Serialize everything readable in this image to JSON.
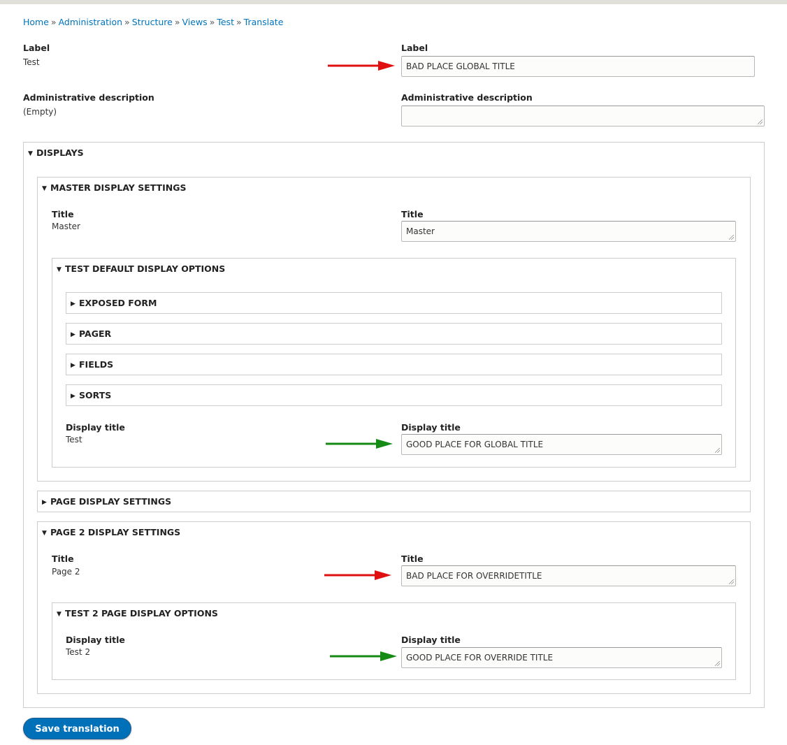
{
  "breadcrumb": {
    "items": [
      "Home",
      "Administration",
      "Structure",
      "Views",
      "Test",
      "Translate"
    ],
    "separator": "»"
  },
  "label": {
    "source_label": "Label",
    "source_value": "Test",
    "translation_label": "Label",
    "translation_value": "BAD PLACE GLOBAL TITLE"
  },
  "admin_description": {
    "source_label": "Administrative description",
    "source_value": "(Empty)",
    "translation_label": "Administrative description",
    "translation_value": ""
  },
  "displays": {
    "summary": "DISPLAYS",
    "expanded": true,
    "master": {
      "summary": "MASTER DISPLAY SETTINGS",
      "expanded": true,
      "title_source_label": "Title",
      "title_source_value": "Master",
      "title_translation_label": "Title",
      "title_translation_value": "Master",
      "options": {
        "summary": "TEST DEFAULT DISPLAY OPTIONS",
        "expanded": true,
        "collapsed_sections": [
          {
            "summary": "EXPOSED FORM",
            "expanded": false
          },
          {
            "summary": "PAGER",
            "expanded": false
          },
          {
            "summary": "FIELDS",
            "expanded": false
          },
          {
            "summary": "SORTS",
            "expanded": false
          }
        ],
        "display_title_source_label": "Display title",
        "display_title_source_value": "Test",
        "display_title_translation_label": "Display title",
        "display_title_translation_value": "GOOD PLACE FOR GLOBAL TITLE"
      }
    },
    "page": {
      "summary": "PAGE DISPLAY SETTINGS",
      "expanded": false
    },
    "page2": {
      "summary": "PAGE 2 DISPLAY SETTINGS",
      "expanded": true,
      "title_source_label": "Title",
      "title_source_value": "Page 2",
      "title_translation_label": "Title",
      "title_translation_value": "BAD PLACE FOR OVERRIDETITLE",
      "options": {
        "summary": "TEST 2 PAGE DISPLAY OPTIONS",
        "expanded": true,
        "display_title_source_label": "Display title",
        "display_title_source_value": "Test 2",
        "display_title_translation_label": "Display title",
        "display_title_translation_value": "GOOD PLACE FOR OVERRIDE TITLE"
      }
    }
  },
  "annotations": {
    "bad_color": "#e01010",
    "good_color": "#158a15"
  },
  "icons": {
    "expanded": "▼",
    "collapsed": "▶"
  },
  "actions": {
    "save_label": "Save translation"
  },
  "colors": {
    "link": "#0074bd",
    "button": "#0071b8",
    "border": "#cccccc"
  }
}
